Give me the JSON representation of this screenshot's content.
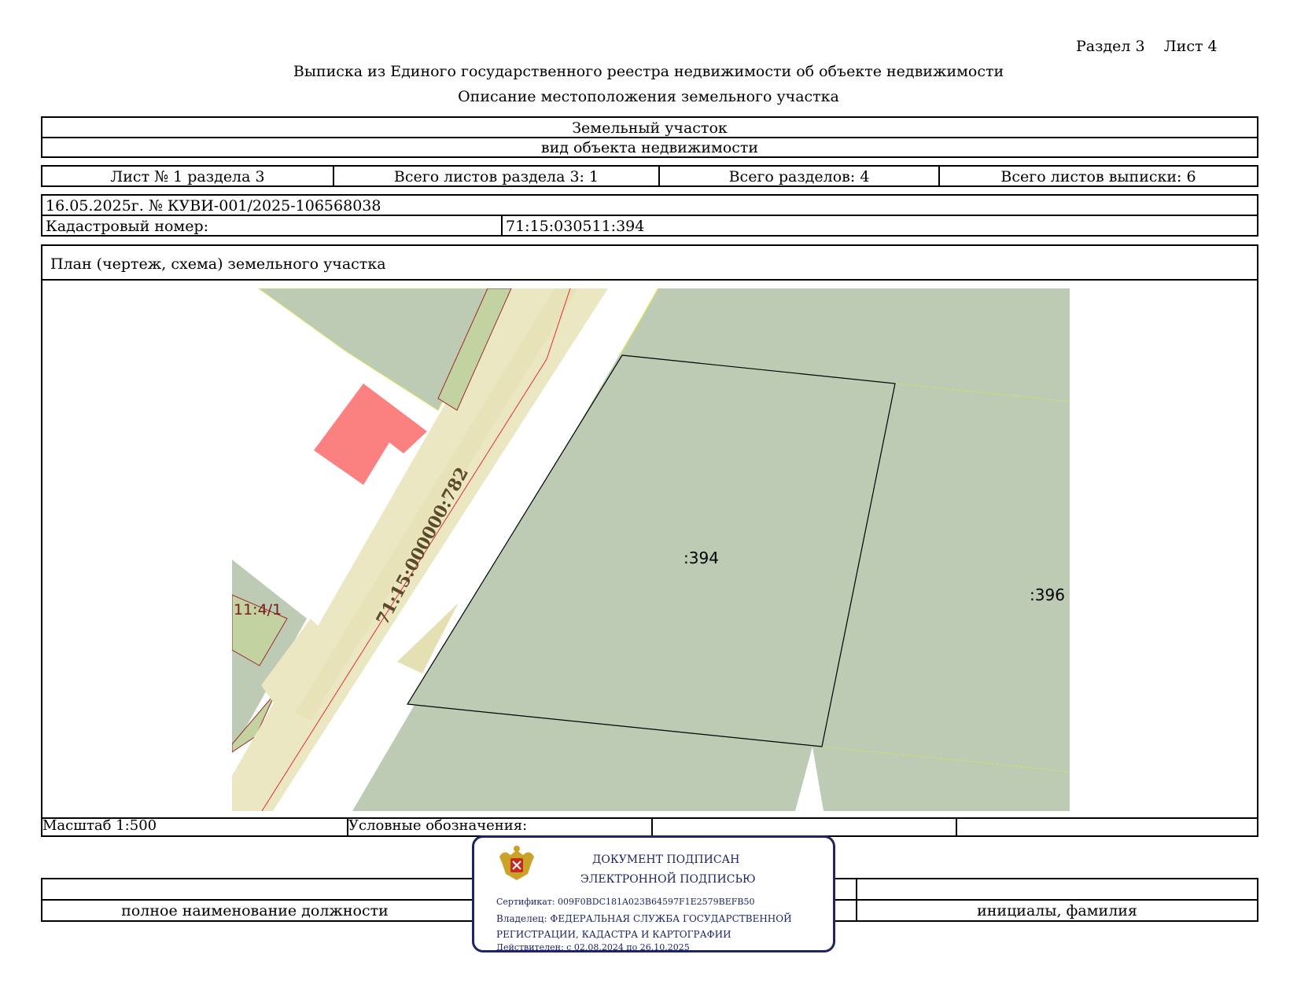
{
  "header": {
    "section_label": "Раздел 3",
    "sheet_label": "Лист 4",
    "doc_title": "Выписка из Единого государственного реестра недвижимости об объекте недвижимости",
    "doc_subtitle": "Описание местоположения земельного участка"
  },
  "object": {
    "type_value": "Земельный участок",
    "type_caption": "вид объекта недвижимости"
  },
  "sheets": {
    "sheet_no": "Лист № 1 раздела 3",
    "total_section_sheets": "Всего листов раздела 3: 1",
    "total_sections": "Всего разделов: 4",
    "total_extract_sheets": "Всего листов выписки: 6"
  },
  "registry": {
    "date_number": "16.05.2025г. № КУВИ-001/2025-106568038",
    "cadastral_label": "Кадастровый номер:",
    "cadastral_value": "71:15:030511:394"
  },
  "plan": {
    "title": "План (чертеж, схема) земельного участка",
    "labels": {
      "parcel_main": ":394",
      "parcel_right": ":396",
      "road": "71:15:000000:782",
      "parcel_left": "11:4/1"
    },
    "colors": {
      "parcel_fill": "#bdcbb5",
      "road_fill": "#ece7c3",
      "building_fill": "#fb8080",
      "small_parcel_fill": "#c3d2a1"
    }
  },
  "footer": {
    "scale": "Масштаб 1:500",
    "legend": "Условные обозначения:",
    "position_caption": "полное наименование должности",
    "name_caption": "инициалы, фамилия"
  },
  "stamp": {
    "line1": "ДОКУМЕНТ ПОДПИСАН",
    "line2": "ЭЛЕКТРОННОЙ ПОДПИСЬЮ",
    "certificate": "Сертификат: 009F0BDC181A023B64597F1E2579BEFB50",
    "owner_line1": "Владелец: ФЕДЕРАЛЬНАЯ СЛУЖБА ГОСУДАРСТВЕННОЙ",
    "owner_line2": "РЕГИСТРАЦИИ, КАДАСТРА И КАРТОГРАФИИ",
    "validity": "Действителен: с 02.08.2024 по 26.10.2025",
    "emblem_icon": "double-headed-eagle-emblem-icon"
  }
}
